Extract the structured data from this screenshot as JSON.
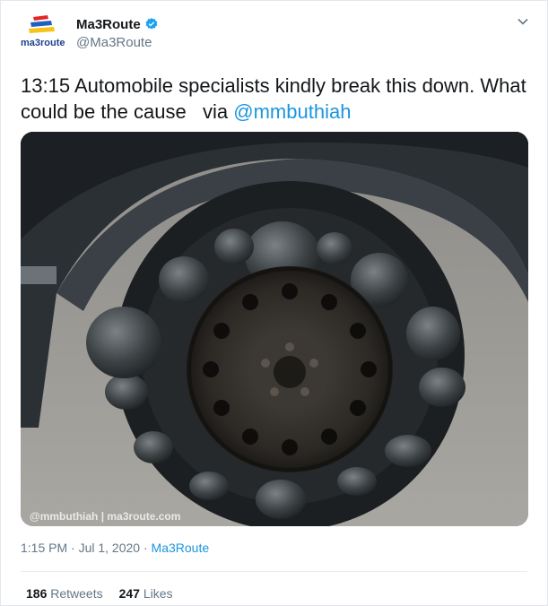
{
  "author": {
    "name": "Ma3Route",
    "handle": "@Ma3Route",
    "logo_text": "ma3route",
    "verified_icon": "verified-badge-icon",
    "avatar_icon": "ma3route-logo"
  },
  "tweet": {
    "text_main": "13:15 Automobile specialists kindly break this down. What could be the cause   via ",
    "mention": "@mmbuthiah",
    "image_watermark": "@mmbuthiah | ma3route.com",
    "time": "1:15 PM · Jul 1, 2020 · ",
    "source": "Ma3Route"
  },
  "stats": {
    "retweets_count": "186",
    "retweets_label": "Retweets",
    "likes_count": "247",
    "likes_label": "Likes"
  },
  "colors": {
    "accent": "#1b95e0",
    "verified": "#1da1f2",
    "muted": "#657786"
  }
}
